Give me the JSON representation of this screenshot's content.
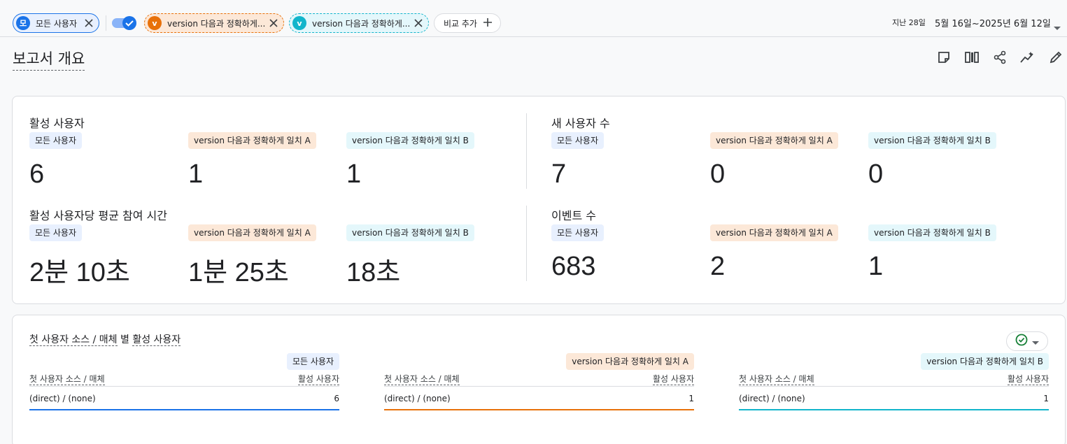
{
  "topbar": {
    "chip_all": {
      "avatar": "모",
      "label": "모든 사용자",
      "color": "#1a73e8"
    },
    "chip_a": {
      "avatar": "v",
      "label": "version 다음과 정확하게...",
      "color": "#e8710a"
    },
    "chip_b": {
      "avatar": "v",
      "label": "version 다음과 정확하게...",
      "color": "#12b5cb"
    },
    "add_compare": "비교 추가",
    "date_prefix": "지난 28일",
    "date_range": "5월 16일~2025년 6월 12일"
  },
  "page_title": "보고서 개요",
  "toolbar_icons": [
    "note-icon",
    "columns-icon",
    "share-icon",
    "insights-icon",
    "edit-icon"
  ],
  "segments": {
    "all": "모든 사용자",
    "a": "version 다음과 정확하게 일치 A",
    "b": "version 다음과 정확하게 일치 B"
  },
  "metrics": {
    "active_users": {
      "title": "활성 사용자",
      "all": "6",
      "a": "1",
      "b": "1"
    },
    "new_users": {
      "title": "새 사용자 수",
      "all": "7",
      "a": "0",
      "b": "0"
    },
    "avg_engagement": {
      "title": "활성 사용자당 평균 참여 시간",
      "all": "2분 10초",
      "a": "1분 25초",
      "b": "18초"
    },
    "event_count": {
      "title": "이벤트 수",
      "all": "683",
      "a": "2",
      "b": "1"
    }
  },
  "table_card": {
    "title_part1": "첫 사용자 소스 / 매체",
    "title_mid": " 별 ",
    "title_part2": "활성 사용자",
    "col_dim": "첫 사용자 소스 / 매체",
    "col_metric": "활성 사용자",
    "rows": {
      "all": {
        "dim": "(direct) / (none)",
        "value": "6"
      },
      "a": {
        "dim": "(direct) / (none)",
        "value": "1"
      },
      "b": {
        "dim": "(direct) / (none)",
        "value": "1"
      }
    }
  },
  "colors": {
    "blue": "#1a73e8",
    "orange": "#e8710a",
    "teal": "#12b5cb",
    "green": "#188038"
  }
}
